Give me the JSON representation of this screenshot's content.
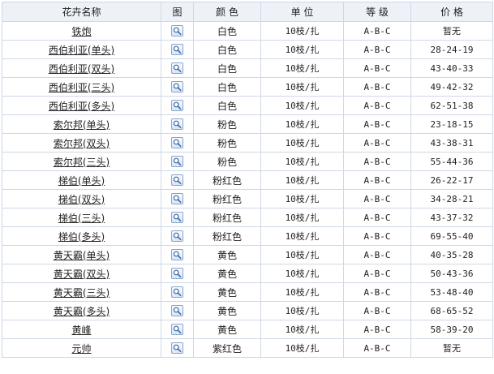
{
  "header": {
    "name": "花卉名称",
    "image": "图",
    "color": "颜 色",
    "unit": "单 位",
    "grade": "等 级",
    "price": "价 格"
  },
  "icons": {
    "row_image": "magnifier-icon"
  },
  "colors": {
    "border": "#cfd8e6",
    "header_bg": "#eef2f8",
    "icon_border": "#8aa4c8"
  },
  "rows": [
    {
      "name": "铁炮",
      "color": "白色",
      "unit": "10枝/扎",
      "grade": "A-B-C",
      "price": "暂无"
    },
    {
      "name": "西伯利亚(单头)",
      "color": "白色",
      "unit": "10枝/扎",
      "grade": "A-B-C",
      "price": "28-24-19"
    },
    {
      "name": "西伯利亚(双头)",
      "color": "白色",
      "unit": "10枝/扎",
      "grade": "A-B-C",
      "price": "43-40-33"
    },
    {
      "name": "西伯利亚(三头)",
      "color": "白色",
      "unit": "10枝/扎",
      "grade": "A-B-C",
      "price": "49-42-32"
    },
    {
      "name": "西伯利亚(多头)",
      "color": "白色",
      "unit": "10枝/扎",
      "grade": "A-B-C",
      "price": "62-51-38"
    },
    {
      "name": "索尔邦(单头)",
      "color": "粉色",
      "unit": "10枝/扎",
      "grade": "A-B-C",
      "price": "23-18-15"
    },
    {
      "name": "索尔邦(双头)",
      "color": "粉色",
      "unit": "10枝/扎",
      "grade": "A-B-C",
      "price": "43-38-31"
    },
    {
      "name": "索尔邦(三头)",
      "color": "粉色",
      "unit": "10枝/扎",
      "grade": "A-B-C",
      "price": "55-44-36"
    },
    {
      "name": "梯伯(单头)",
      "color": "粉红色",
      "unit": "10枝/扎",
      "grade": "A-B-C",
      "price": "26-22-17"
    },
    {
      "name": "梯伯(双头)",
      "color": "粉红色",
      "unit": "10枝/扎",
      "grade": "A-B-C",
      "price": "34-28-21"
    },
    {
      "name": "梯伯(三头)",
      "color": "粉红色",
      "unit": "10枝/扎",
      "grade": "A-B-C",
      "price": "43-37-32"
    },
    {
      "name": "梯伯(多头)",
      "color": "粉红色",
      "unit": "10枝/扎",
      "grade": "A-B-C",
      "price": "69-55-40"
    },
    {
      "name": "黄天霸(单头)",
      "color": "黄色",
      "unit": "10枝/扎",
      "grade": "A-B-C",
      "price": "40-35-28"
    },
    {
      "name": "黄天霸(双头)",
      "color": "黄色",
      "unit": "10枝/扎",
      "grade": "A-B-C",
      "price": "50-43-36"
    },
    {
      "name": "黄天霸(三头)",
      "color": "黄色",
      "unit": "10枝/扎",
      "grade": "A-B-C",
      "price": "53-48-40"
    },
    {
      "name": "黄天霸(多头)",
      "color": "黄色",
      "unit": "10枝/扎",
      "grade": "A-B-C",
      "price": "68-65-52"
    },
    {
      "name": "黄峰",
      "color": "黄色",
      "unit": "10枝/扎",
      "grade": "A-B-C",
      "price": "58-39-20"
    },
    {
      "name": "元帅",
      "color": "紫红色",
      "unit": "10枝/扎",
      "grade": "A-B-C",
      "price": "暂无"
    }
  ]
}
